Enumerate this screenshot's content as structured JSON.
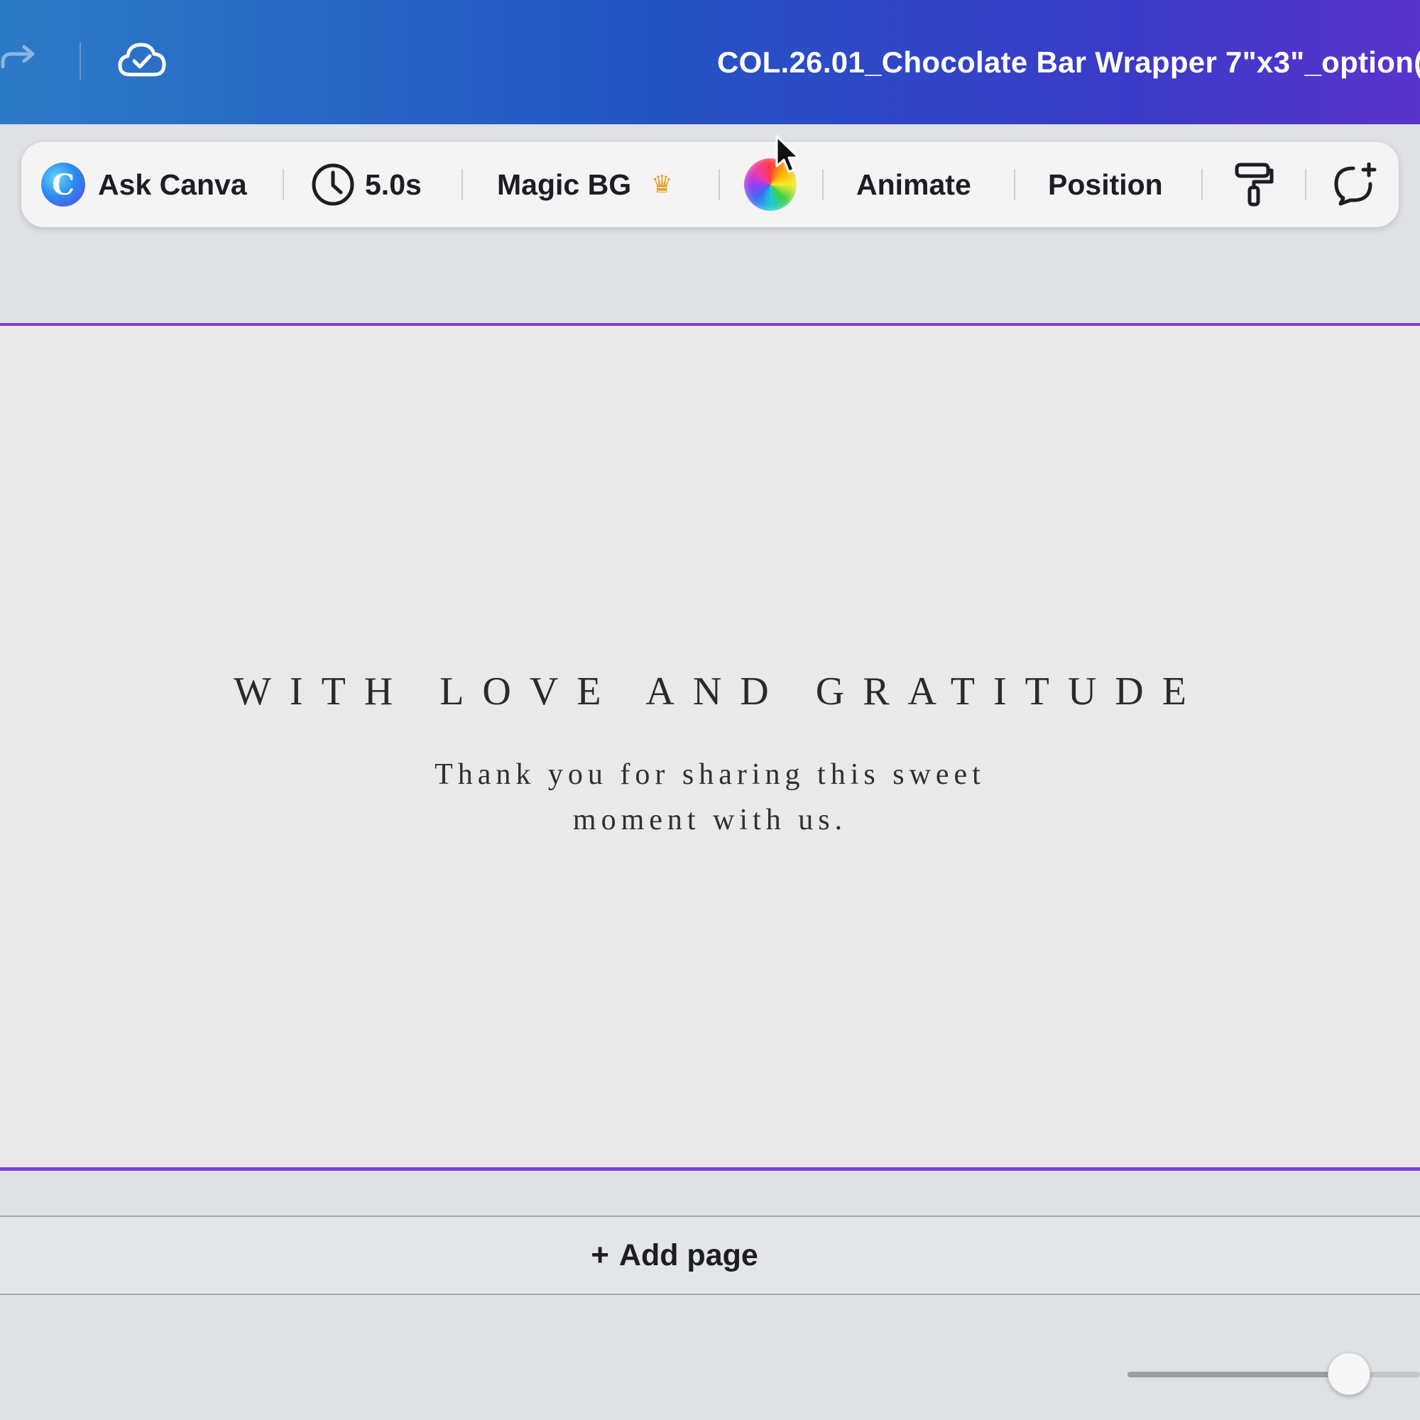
{
  "header": {
    "document_title": "COL.26.01_Chocolate Bar Wrapper 7\"x3\"_option(",
    "icons": [
      "redo-icon",
      "cloud-saved-icon"
    ]
  },
  "toolbar": {
    "ask_canva_label": "Ask Canva",
    "duration_label": "5.0s",
    "magic_bg_label": "Magic BG",
    "animate_label": "Animate",
    "position_label": "Position",
    "icons": [
      "canva-assistant-logo",
      "clock-icon",
      "crown-icon",
      "color-wheel-icon",
      "paint-roller-icon",
      "comment-add-icon"
    ]
  },
  "canvas": {
    "headline": "WITH LOVE AND GRATITUDE",
    "subline_1": "Thank you for sharing this sweet",
    "subline_2": "moment with us."
  },
  "footer": {
    "add_page_label": "Add page",
    "add_page_icon": "plus-icon",
    "zoom_slider_value": 0.7
  },
  "colors": {
    "header_gradient_start": "#2c7ac7",
    "header_gradient_end": "#5a34cc",
    "page_selection_border": "#7d3fd8",
    "crown": "#e0a22c"
  }
}
